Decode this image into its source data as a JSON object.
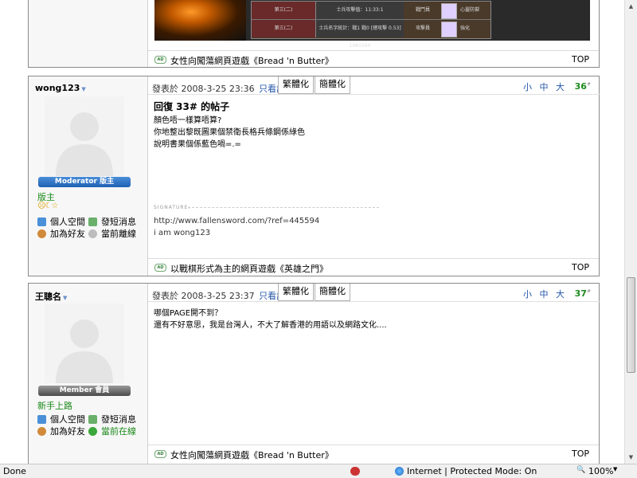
{
  "prev_post": {
    "image_rows": [
      {
        "name": "第三(二)",
        "info": "士兵攻擊值：11:33:1",
        "type": "戰鬥員",
        "extra": "心靈防禦"
      },
      {
        "name": "第三(二)",
        "info": "士兵名字統計：戰1 戰0 [總攻擊 0.53] 1981594",
        "type": "攻擊員",
        "extra": "強化"
      }
    ],
    "footer_ad": "女性向闖蕩網頁遊戲《Bread 'n Butter》",
    "top_label": "TOP"
  },
  "posts": [
    {
      "username": "wong123",
      "rank_badge": "Moderator 版主",
      "group": "版主",
      "stars": "☹☾☆",
      "actions": {
        "space": "個人空間",
        "pm": "發短消息",
        "friend": "加為好友",
        "status": "當前離線"
      },
      "meta": "發表於 2008-3-25 23:36",
      "author_only": "只看該作者",
      "conv_trad": "繁體化",
      "conv_simp": "簡體化",
      "font_size": "小 中 大",
      "floor": "36",
      "floor_sup": "#",
      "title": "回復 33# 的帖子",
      "body": [
        "顏色唔一樣算唔算?",
        "你地整出黎既圖果個禁衛長格兵條鋼係綠色",
        "說明書果個係藍色喎=.="
      ],
      "sig_label": "SIGNATURE:",
      "signature": [
        "http://www.fallensword.com/?ref=445594",
        "i am wong123"
      ],
      "footer_ad": "以戰棋形式為主的網頁遊戲《英雄之門》",
      "top_label": "TOP"
    },
    {
      "username": "王聰名",
      "rank_badge": "Member 會員",
      "group": "新手上路",
      "actions": {
        "space": "個人空間",
        "pm": "發短消息",
        "friend": "加為好友",
        "status": "當前在線"
      },
      "meta": "發表於 2008-3-25 23:37",
      "author_only": "只看該作者",
      "conv_trad": "繁體化",
      "conv_simp": "簡體化",
      "font_size": "小 中 大",
      "floor": "37",
      "floor_sup": "#",
      "body": [
        "哪個PAGE開不到？",
        "還有不好意思，我是台灣人，不大了解香港的用語以及網路文化...."
      ],
      "footer_ad": "女性向闖蕩網頁遊戲《Bread 'n Butter》",
      "top_label": "TOP"
    }
  ],
  "statusbar": {
    "left": "Done",
    "zone": "Internet | Protected Mode: On",
    "zoom": "100%"
  },
  "colors": {
    "moderator": "#1e5fb3",
    "group_green": "#1b8a1b",
    "link_blue": "#2255aa"
  },
  "icons": [
    "home-icon",
    "message-icon",
    "add-friend-icon",
    "user-status-icon",
    "globe-icon",
    "zoom-icon",
    "security-icon"
  ]
}
